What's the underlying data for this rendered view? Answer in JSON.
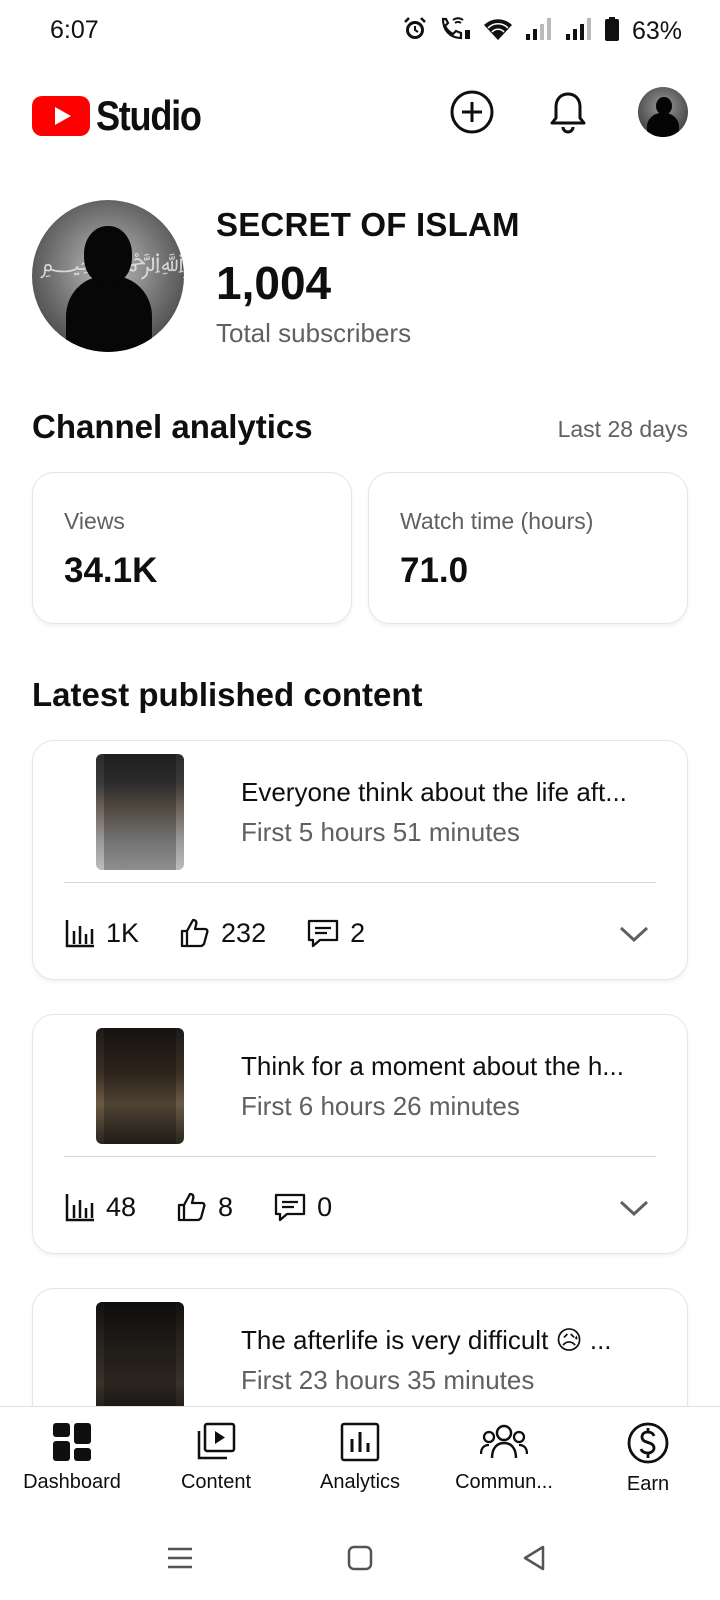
{
  "status_bar": {
    "time": "6:07",
    "battery": "63%",
    "icons": [
      "alarm-icon",
      "wifi-calling-icon",
      "wifi-icon",
      "signal-icon",
      "signal-icon",
      "battery-icon"
    ]
  },
  "app_bar": {
    "logo_text": "Studio",
    "brand_color": "#ff0000",
    "actions": [
      "create-icon",
      "bell-icon",
      "avatar"
    ]
  },
  "channel": {
    "name": "SECRET OF ISLAM",
    "subscriber_count": "1,004",
    "subscriber_label": "Total subscribers"
  },
  "analytics": {
    "title": "Channel analytics",
    "range": "Last 28 days",
    "cards": [
      {
        "label": "Views",
        "value": "34.1K"
      },
      {
        "label": "Watch time (hours)",
        "value": "71.0"
      }
    ]
  },
  "latest": {
    "title": "Latest published content",
    "items": [
      {
        "title": "Everyone think about the life aft...",
        "subtitle": "First 5 hours 51 minutes",
        "views": "1K",
        "likes": "232",
        "comments": "2"
      },
      {
        "title": "Think for a moment about the h...",
        "subtitle": "First 6 hours 26 minutes",
        "views": "48",
        "likes": "8",
        "comments": "0"
      },
      {
        "title": "The afterlife is very difficult 😥 ...",
        "subtitle": "First 23 hours 35 minutes"
      }
    ]
  },
  "bottom_nav": {
    "items": [
      {
        "label": "Dashboard",
        "icon": "dashboard-icon"
      },
      {
        "label": "Content",
        "icon": "content-icon"
      },
      {
        "label": "Analytics",
        "icon": "analytics-icon"
      },
      {
        "label": "Commun...",
        "icon": "community-icon"
      },
      {
        "label": "Earn",
        "icon": "earn-icon"
      }
    ]
  },
  "system_nav": [
    "recents-icon",
    "home-icon",
    "back-icon"
  ]
}
